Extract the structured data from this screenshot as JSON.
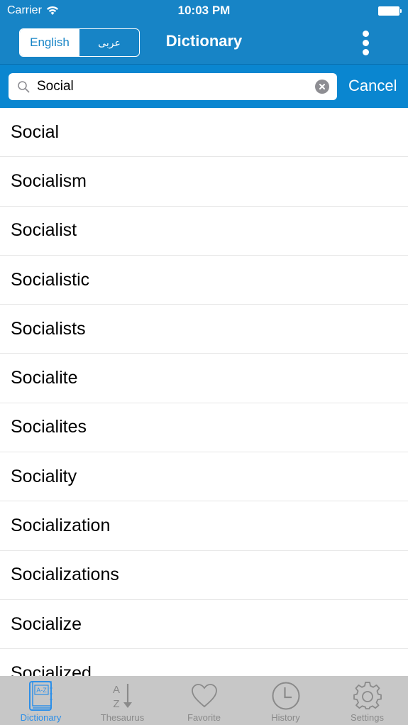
{
  "status_bar": {
    "carrier": "Carrier",
    "time": "10:03 PM",
    "wifi_icon": "wifi-icon",
    "battery_icon": "battery-full-icon"
  },
  "nav": {
    "title": "Dictionary",
    "language_toggle": [
      {
        "label": "English",
        "selected": true
      },
      {
        "label": "عربی",
        "selected": false
      }
    ],
    "more_icon": "more-vertical-icon"
  },
  "search": {
    "value": "Social",
    "placeholder": "",
    "cancel_label": "Cancel",
    "search_icon": "magnifier-icon",
    "clear_icon": "clear-circle-icon"
  },
  "results": [
    "Social",
    "Socialism",
    "Socialist",
    "Socialistic",
    "Socialists",
    "Socialite",
    "Socialites",
    "Sociality",
    "Socialization",
    "Socializations",
    "Socialize",
    "Socialized"
  ],
  "tabbar": {
    "items": [
      {
        "label": "Dictionary",
        "icon": "book-a-z-icon",
        "active": true
      },
      {
        "label": "Thesaurus",
        "icon": "sort-a-z-icon",
        "active": false
      },
      {
        "label": "Favorite",
        "icon": "heart-icon",
        "active": false
      },
      {
        "label": "History",
        "icon": "clock-icon",
        "active": false
      },
      {
        "label": "Settings",
        "icon": "gear-icon",
        "active": false
      }
    ]
  },
  "colors": {
    "header": "#1784c6",
    "search_bar": "#0a86d0",
    "tab_bar": "#c7c7c7",
    "tab_active": "#2d8fe8",
    "tab_inactive": "#8a8a8a"
  }
}
